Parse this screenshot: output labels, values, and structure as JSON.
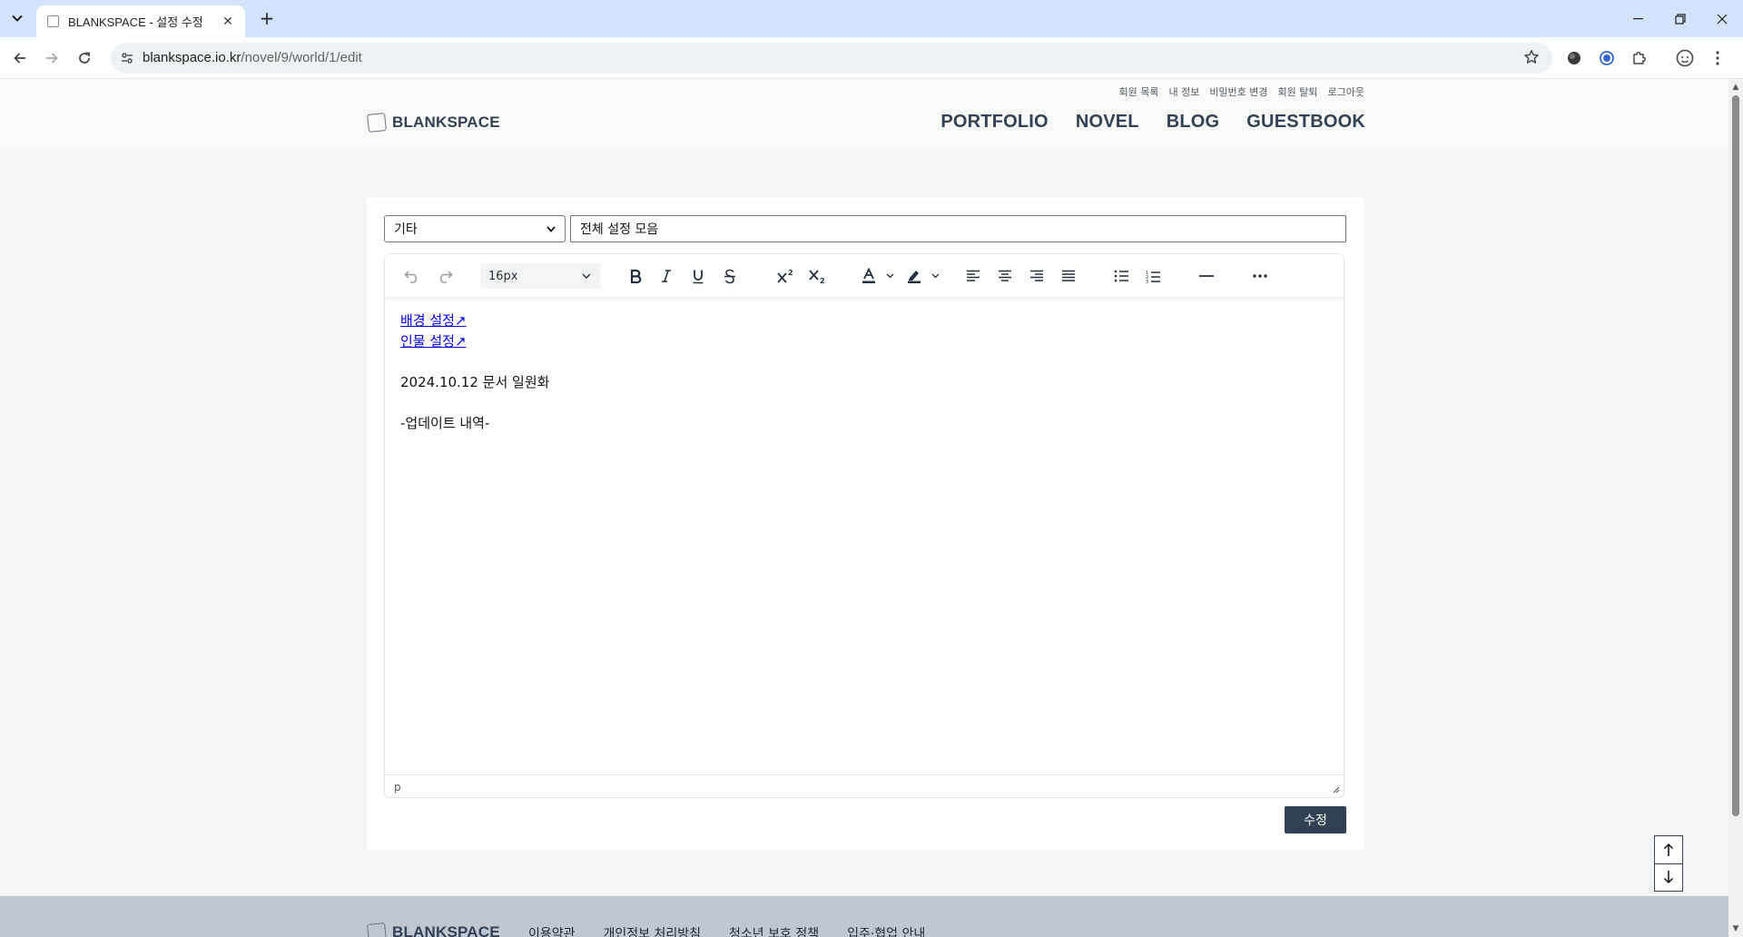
{
  "browser": {
    "tab_title": "BLANKSPACE - 설정 수정",
    "url_host": "blankspace.io.kr",
    "url_path": "/novel/9/world/1/edit"
  },
  "header": {
    "logo_text": "BLANKSPACE",
    "user_links": [
      "회원 목록",
      "내 정보",
      "비밀번호 변경",
      "회원 탈퇴",
      "로그아웃"
    ],
    "nav": [
      "PORTFOLIO",
      "NOVEL",
      "BLOG",
      "GUESTBOOK"
    ]
  },
  "form": {
    "category_value": "기타",
    "title_value": "전체 설정 모음",
    "submit_label": "수정"
  },
  "editor": {
    "font_size": "16px",
    "status_path": "p",
    "content": {
      "link1": "배경 설정↗",
      "link2": "인물 설정↗",
      "line1": "2024.10.12 문서 일원화",
      "line2": "-업데이트 내역-"
    }
  },
  "footer": {
    "logo_text": "BLANKSPACE",
    "links": [
      "이용약관",
      "개인정보 처리방침",
      "청소년 보호 정책",
      "입주·협업 안내"
    ]
  },
  "colors": {
    "brand": "#334155",
    "tabbar": "#d3e3fd",
    "footer": "#c0c7d1",
    "link": "#0000ee"
  }
}
